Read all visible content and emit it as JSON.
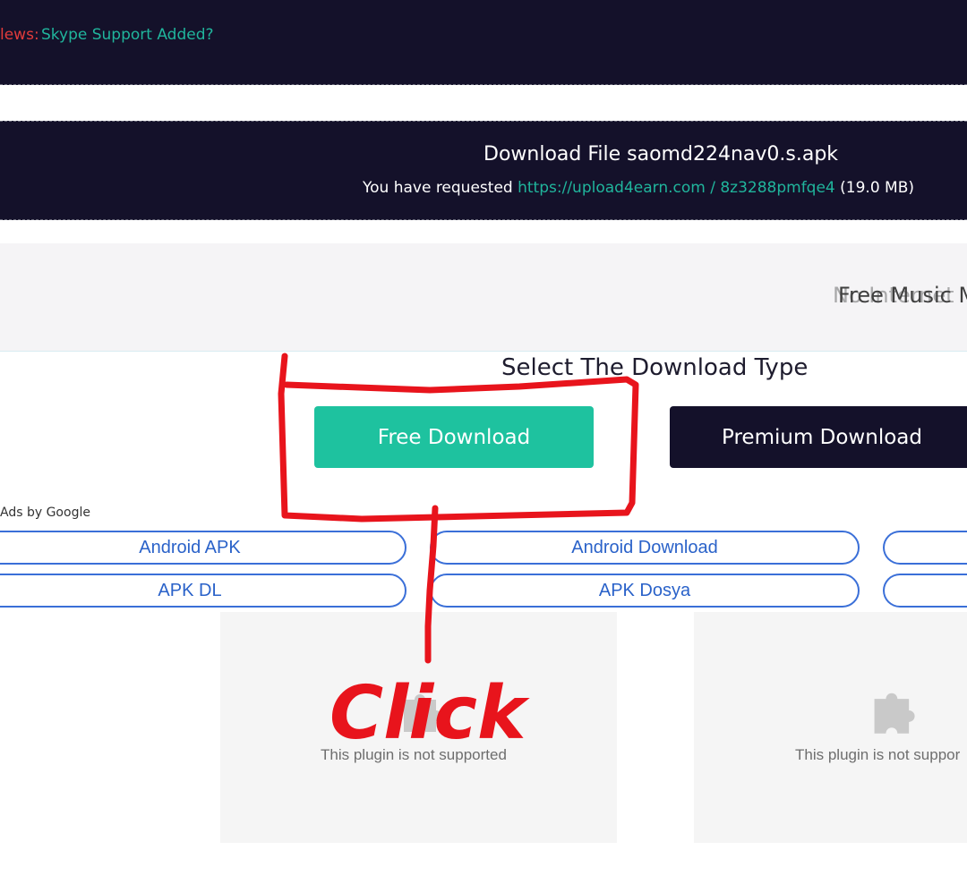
{
  "news": {
    "label": "lews:",
    "text": "Skype Support Added?"
  },
  "download": {
    "title": "Download File saomd224nav0.s.apk",
    "requested_prefix": "You have requested",
    "link": "https://upload4earn.com / 8z3288pmfqe4",
    "size": "(19.0 MB)"
  },
  "ad_strip": {
    "marquee_back": "No Internet",
    "marquee_front": "Free Music M"
  },
  "select_title": "Select The Download Type",
  "buttons": {
    "free": "Free Download",
    "premium": "Premium Download"
  },
  "ads": {
    "label": "Ads by Google",
    "links": [
      {
        "label": "Android APK"
      },
      {
        "label": "Android Download"
      },
      {
        "label": ""
      },
      {
        "label": "APK DL"
      },
      {
        "label": "APK Dosya"
      },
      {
        "label": ""
      }
    ]
  },
  "plugins": [
    {
      "text": "This plugin is not supported",
      "icon": "puzzle-icon"
    },
    {
      "text": "This plugin is not suppor",
      "icon": "puzzle-icon"
    }
  ],
  "annotation": {
    "text": "Click",
    "color": "#e8141c"
  }
}
